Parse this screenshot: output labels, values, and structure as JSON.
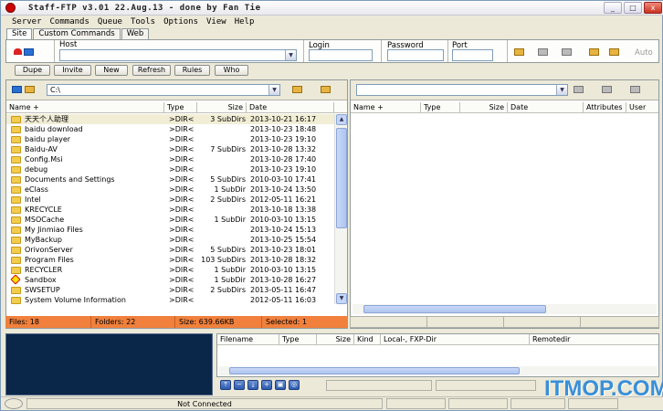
{
  "window": {
    "title": "Staff-FTP v3.01 22.Aug.13 - done by Fan Tie",
    "minimize": "_",
    "maximize": "□",
    "close": "x"
  },
  "menu": [
    "Server",
    "Commands",
    "Queue",
    "Tools",
    "Options",
    "View",
    "Help"
  ],
  "tabs": [
    {
      "label": "Site",
      "active": true
    },
    {
      "label": "Custom Commands",
      "active": false
    },
    {
      "label": "Web",
      "active": false
    }
  ],
  "connection": {
    "host_label": "Host",
    "host_value": "",
    "login_label": "Login",
    "login_value": "",
    "password_label": "Password",
    "password_value": "",
    "port_label": "Port",
    "port_value": "",
    "auto_label": "Auto"
  },
  "commands": [
    "Dupe",
    "Invite",
    "New",
    "Refresh",
    "Rules",
    "Who"
  ],
  "local": {
    "path": "C:\\",
    "columns": [
      "Name +",
      "Type",
      "Size",
      "Date"
    ],
    "rows": [
      {
        "name": "天天个人助理",
        "type": ">DIR<",
        "size": "3 SubDirs",
        "date": "2013-10-21 16:17",
        "icon": "folder-icon",
        "selected": true
      },
      {
        "name": "baidu download",
        "type": ">DIR<",
        "size": "",
        "date": "2013-10-23 18:48",
        "icon": "folder-icon"
      },
      {
        "name": "baidu player",
        "type": ">DIR<",
        "size": "",
        "date": "2013-10-23 19:10",
        "icon": "folder-icon"
      },
      {
        "name": "Baidu-AV",
        "type": ">DIR<",
        "size": "7 SubDirs",
        "date": "2013-10-28 13:32",
        "icon": "folder-icon"
      },
      {
        "name": "Config.Msi",
        "type": ">DIR<",
        "size": "",
        "date": "2013-10-28 17:40",
        "icon": "folder-icon"
      },
      {
        "name": "debug",
        "type": ">DIR<",
        "size": "",
        "date": "2013-10-23 19:10",
        "icon": "folder-icon"
      },
      {
        "name": "Documents and Settings",
        "type": ">DIR<",
        "size": "5 SubDirs",
        "date": "2010-03-10 17:41",
        "icon": "folder-icon"
      },
      {
        "name": "eClass",
        "type": ">DIR<",
        "size": "1 SubDir",
        "date": "2013-10-24 13:50",
        "icon": "folder-icon"
      },
      {
        "name": "Intel",
        "type": ">DIR<",
        "size": "2 SubDirs",
        "date": "2012-05-11 16:21",
        "icon": "folder-icon"
      },
      {
        "name": "KRECYCLE",
        "type": ">DIR<",
        "size": "",
        "date": "2013-10-18 13:38",
        "icon": "folder-icon"
      },
      {
        "name": "MSOCache",
        "type": ">DIR<",
        "size": "1 SubDir",
        "date": "2010-03-10 13:15",
        "icon": "folder-icon"
      },
      {
        "name": "My Jinmiao Files",
        "type": ">DIR<",
        "size": "",
        "date": "2013-10-24 15:13",
        "icon": "folder-icon"
      },
      {
        "name": "MyBackup",
        "type": ">DIR<",
        "size": "",
        "date": "2013-10-25 15:54",
        "icon": "folder-icon"
      },
      {
        "name": "OrivonServer",
        "type": ">DIR<",
        "size": "5 SubDirs",
        "date": "2013-10-23 18:01",
        "icon": "folder-icon"
      },
      {
        "name": "Program Files",
        "type": ">DIR<",
        "size": "103 SubDirs",
        "date": "2013-10-28 18:32",
        "icon": "folder-icon"
      },
      {
        "name": "RECYCLER",
        "type": ">DIR<",
        "size": "1 SubDir",
        "date": "2010-03-10 13:15",
        "icon": "folder-icon"
      },
      {
        "name": "Sandbox",
        "type": ">DIR<",
        "size": "1 SubDir",
        "date": "2013-10-28 16:27",
        "icon": "sandbox-icon"
      },
      {
        "name": "SWSETUP",
        "type": ">DIR<",
        "size": "2 SubDirs",
        "date": "2013-05-11 16:47",
        "icon": "folder-icon"
      },
      {
        "name": "System Volume Information",
        "type": ">DIR<",
        "size": "",
        "date": "2012-05-11 16:03",
        "icon": "folder-icon"
      }
    ],
    "status": {
      "files": "Files: 18",
      "folders": "Folders: 22",
      "size": "Size: 639.66KB",
      "selected": "Selected: 1"
    }
  },
  "remote": {
    "path": "",
    "columns": [
      "Name +",
      "Type",
      "Size",
      "Date",
      "Attributes",
      "User"
    ]
  },
  "queue": {
    "columns": [
      "Filename",
      "Type",
      "Size",
      "Kind",
      "Local-, FXP-Dir",
      "Remotedir"
    ]
  },
  "statusbar": {
    "connection": "Not Connected"
  },
  "watermark": "ITMOP.COM",
  "colors": {
    "status_bar_local": "#f0803c",
    "log_background": "#0a2648",
    "watermark": "#3a8fd8"
  }
}
